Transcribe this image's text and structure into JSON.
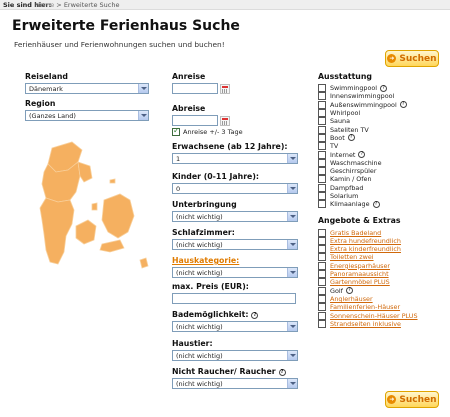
{
  "breadcrumb": {
    "label": "Sie sind hier:",
    "home": "Home",
    "separator": ">",
    "current": "Erweiterte Suche"
  },
  "page": {
    "title": "Erweiterte Ferienhaus Suche",
    "subtitle": "Ferienhäuser und Ferienwohnungen suchen und buchen!"
  },
  "search_button": {
    "label": "Suchen",
    "icon": "arrow-right-icon"
  },
  "left": {
    "reiseland": {
      "label": "Reiseland",
      "value": "Dänemark"
    },
    "region": {
      "label": "Region",
      "value": "(Ganzes Land)"
    },
    "map": {
      "icon": "denmark-map",
      "color": "#f5b060"
    }
  },
  "middle": {
    "anreise": {
      "label": "Anreise",
      "value": ""
    },
    "abreise": {
      "label": "Abreise",
      "value": ""
    },
    "flex": {
      "label": "Anreise +/- 3 Tage",
      "checked": true
    },
    "erwachsene": {
      "label": "Erwachsene (ab 12 Jahre):",
      "value": "1"
    },
    "kinder": {
      "label": "Kinder (0-11 Jahre):",
      "value": "0"
    },
    "unterbringung": {
      "label": "Unterbringung",
      "value": "(nicht wichtig)"
    },
    "schlafzimmer": {
      "label": "Schlafzimmer:",
      "value": "(nicht wichtig)"
    },
    "hauskategorie": {
      "label": "Hauskategorie:",
      "value": "(nicht wichtig)"
    },
    "preis": {
      "label": "max. Preis (EUR):",
      "value": ""
    },
    "bad": {
      "label": "Bademöglichkeit:",
      "value": "(nicht wichtig)"
    },
    "haustier": {
      "label": "Haustier:",
      "value": "(nicht wichtig)"
    },
    "raucher": {
      "label": "Nicht Raucher/ Raucher",
      "value": "(nicht wichtig)"
    }
  },
  "right": {
    "ausstattung_title": "Ausstattung",
    "ausstattung": [
      {
        "label": "Swimmingpool",
        "help": true
      },
      {
        "label": "Innenswimmingpool",
        "help": false
      },
      {
        "label": "Außenswimmingpool",
        "help": true
      },
      {
        "label": "Whirlpool",
        "help": false
      },
      {
        "label": "Sauna",
        "help": false
      },
      {
        "label": "Sateliten TV",
        "help": false
      },
      {
        "label": "Boot",
        "help": true
      },
      {
        "label": "TV",
        "help": false
      },
      {
        "label": "Internet",
        "help": true
      },
      {
        "label": "Waschmaschine",
        "help": false
      },
      {
        "label": "Geschirrspüler",
        "help": false
      },
      {
        "label": "Kamin / Ofen",
        "help": false
      },
      {
        "label": "Dampfbad",
        "help": false
      },
      {
        "label": "Solarium",
        "help": false
      },
      {
        "label": "Klimaanlage",
        "help": true
      }
    ],
    "angebote_title": "Angebote & Extras",
    "angebote": [
      {
        "label": "Gratis Badeland",
        "link": true
      },
      {
        "label": "Extra hundefreundlich",
        "link": true
      },
      {
        "label": "Extra kinderfreundlich",
        "link": true
      },
      {
        "label": "Toiletten zwei",
        "link": true
      },
      {
        "label": "Energiesparhäuser",
        "link": true
      },
      {
        "label": "Panoramaaussicht",
        "link": true
      },
      {
        "label": "Gartenmöbel PLUS",
        "link": true
      },
      {
        "label": "Golf",
        "link": false,
        "help": true
      },
      {
        "label": "Anglerhäuser",
        "link": true
      },
      {
        "label": "Familienferien-Häuser",
        "link": true
      },
      {
        "label": "Sonnenschein-Häuser PLUS",
        "link": true
      },
      {
        "label": "Strandseiten inklusive",
        "link": true
      }
    ]
  },
  "colors": {
    "accent": "#e07b00",
    "button_bg": "#ffd75a",
    "map": "#f5b060"
  }
}
